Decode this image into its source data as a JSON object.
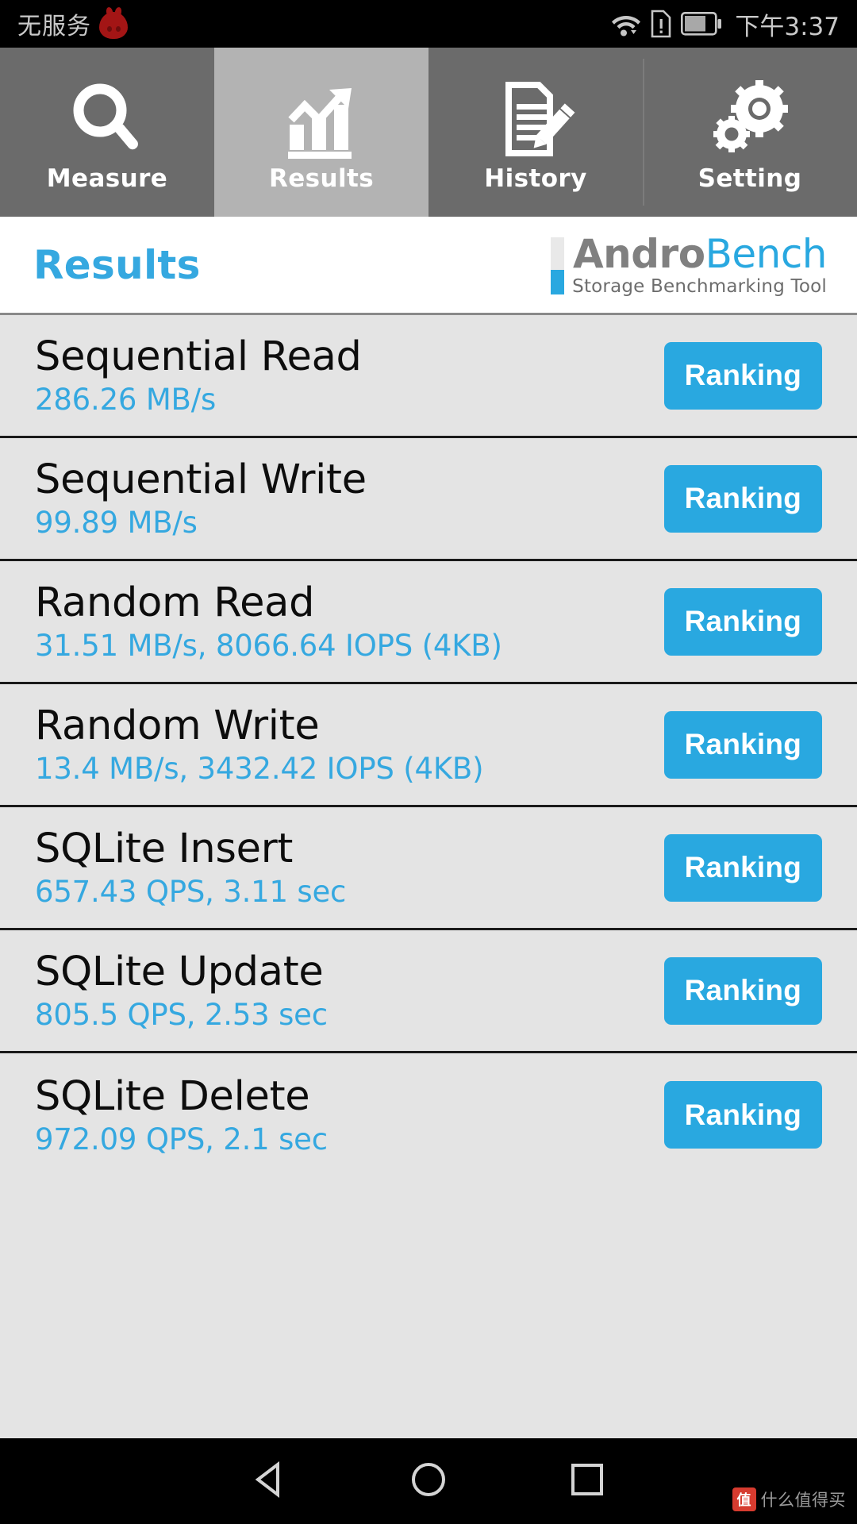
{
  "statusbar": {
    "carrier": "无服务",
    "carrier_icon": "antutu-flame-icon",
    "icons": [
      "wifi-icon",
      "sim-card-alert-icon",
      "battery-icon"
    ],
    "time": "下午3:37"
  },
  "tabs": [
    {
      "label": "Measure",
      "icon": "magnifier-icon",
      "active": false
    },
    {
      "label": "Results",
      "icon": "bar-chart-arrow-icon",
      "active": true
    },
    {
      "label": "History",
      "icon": "document-pencil-icon",
      "active": false
    },
    {
      "label": "Setting",
      "icon": "gears-icon",
      "active": false
    }
  ],
  "header": {
    "title": "Results",
    "logo_andro": "Andro",
    "logo_bench": "Bench",
    "logo_subtitle": "Storage Benchmarking Tool"
  },
  "results": {
    "button_label": "Ranking",
    "rows": [
      {
        "title": "Sequential Read",
        "value": "286.26 MB/s"
      },
      {
        "title": "Sequential Write",
        "value": "99.89 MB/s"
      },
      {
        "title": "Random Read",
        "value": "31.51 MB/s, 8066.64 IOPS (4KB)"
      },
      {
        "title": "Random Write",
        "value": "13.4 MB/s, 3432.42 IOPS (4KB)"
      },
      {
        "title": "SQLite Insert",
        "value": "657.43 QPS, 3.11 sec"
      },
      {
        "title": "SQLite Update",
        "value": "805.5 QPS, 2.53 sec"
      },
      {
        "title": "SQLite Delete",
        "value": "972.09 QPS, 2.1 sec"
      }
    ]
  },
  "navbar": {
    "back": "back-triangle-icon",
    "home": "home-circle-icon",
    "recents": "recents-square-icon",
    "watermark_badge": "值",
    "watermark_text": "什么值得买"
  },
  "colors": {
    "accent_blue": "#29a8e0",
    "value_blue": "#35a8e0",
    "tab_inactive": "#6b6b6b",
    "tab_active": "#b3b3b3",
    "list_bg": "#e4e4e4"
  }
}
